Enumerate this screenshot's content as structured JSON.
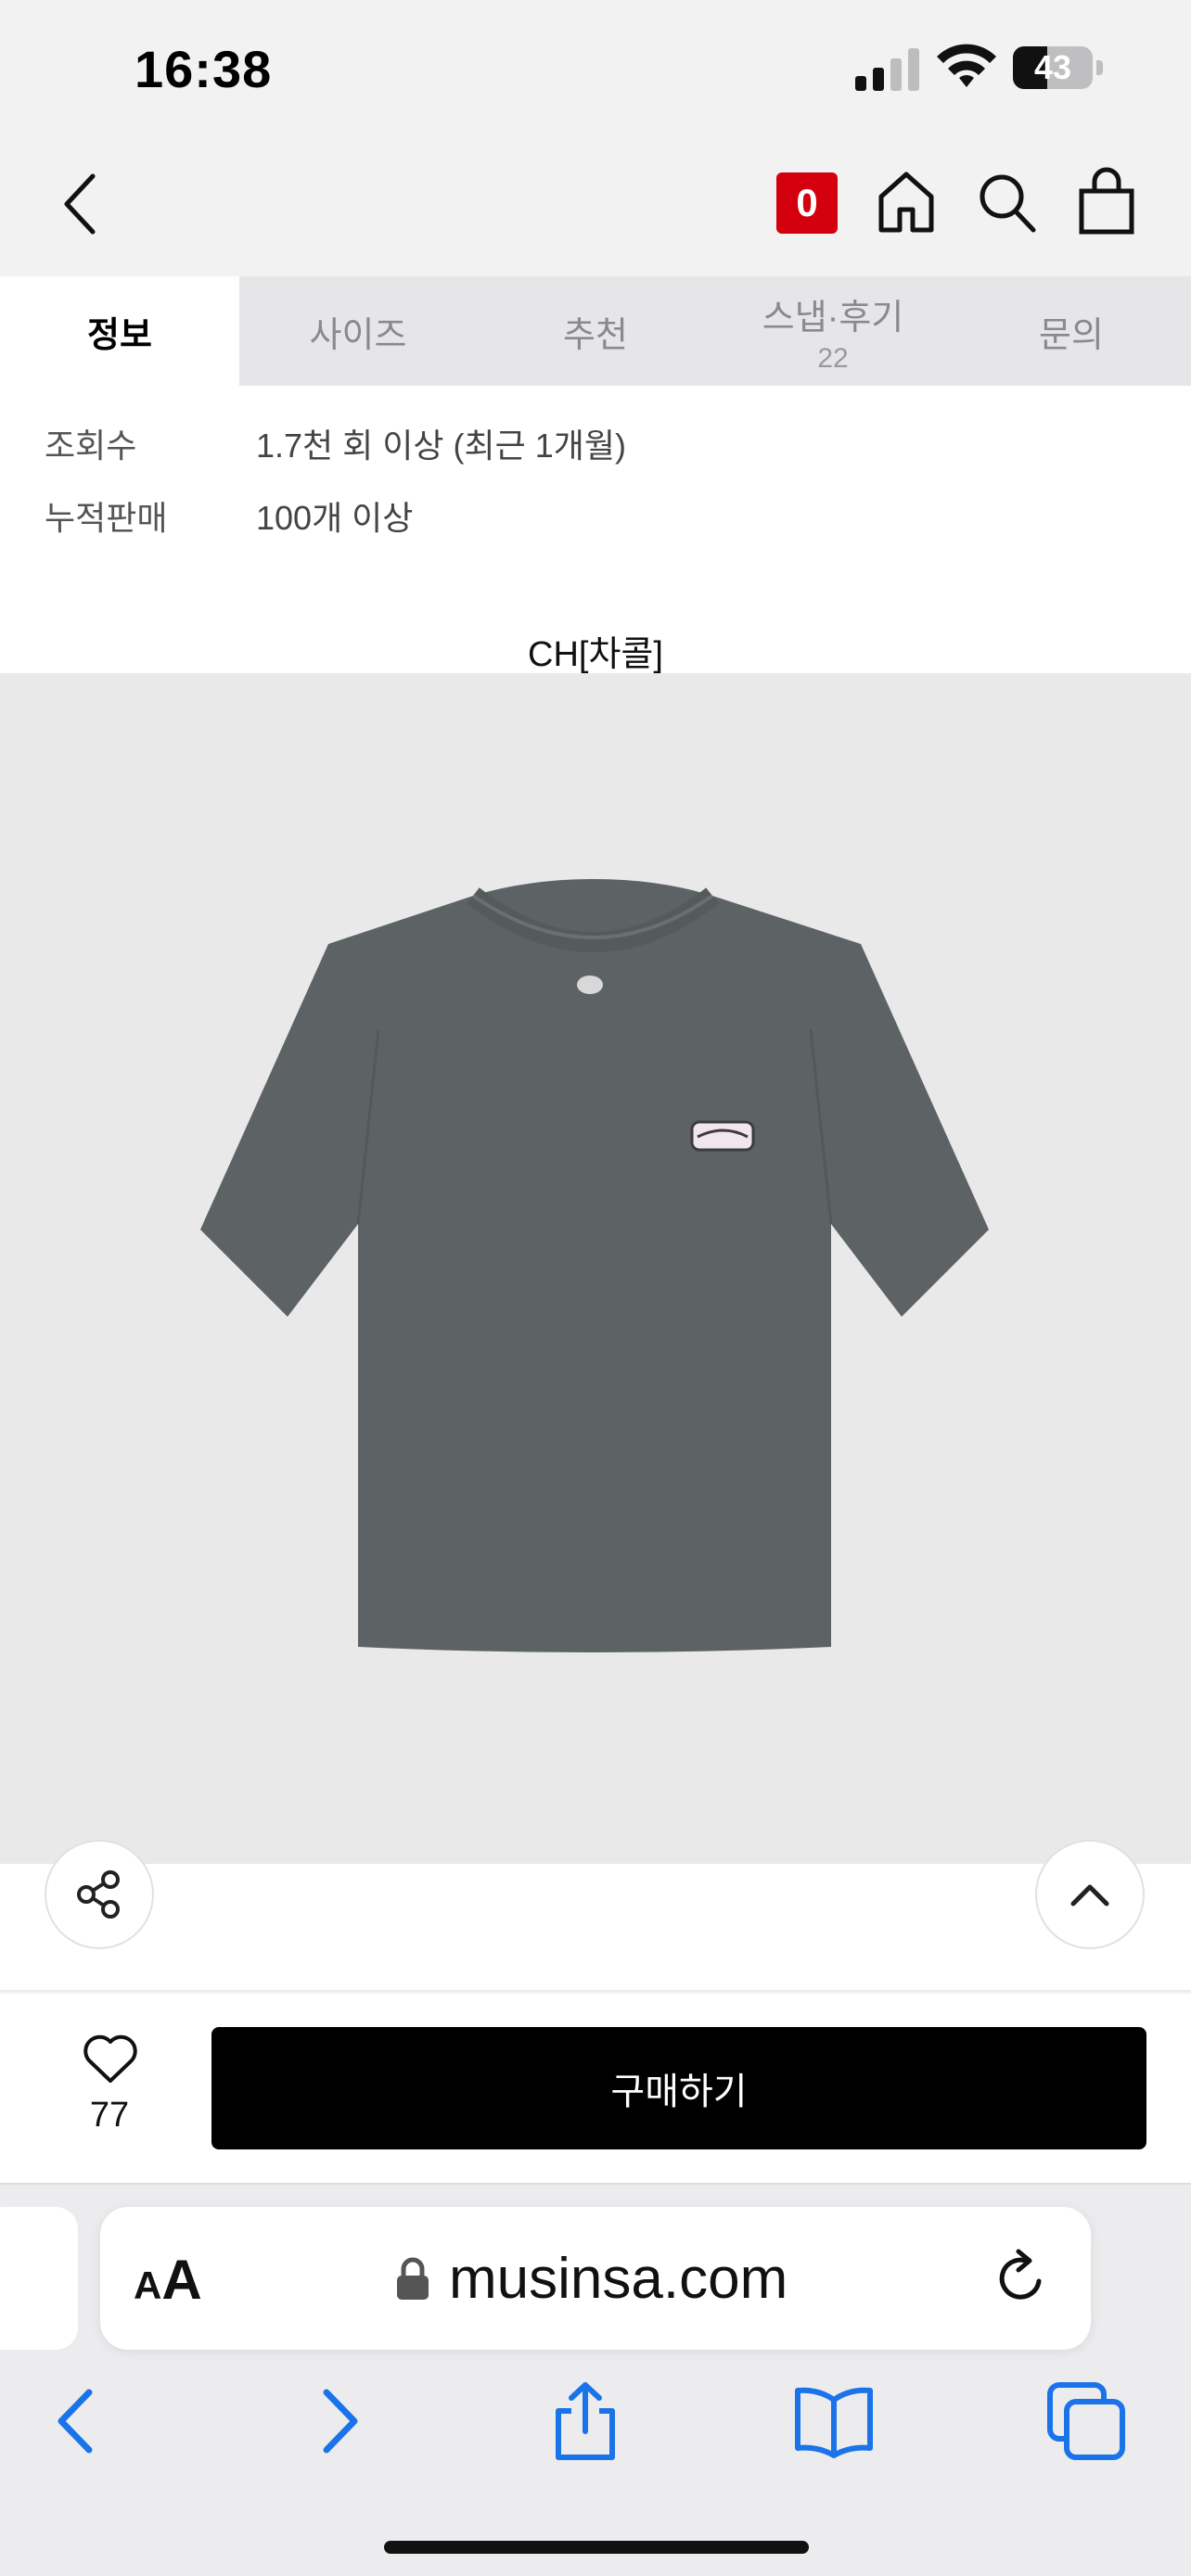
{
  "status_bar": {
    "time": "16:38",
    "battery": "43",
    "battery_level": 0.43
  },
  "header": {
    "icons": [
      "back-icon",
      "home-icon",
      "search-icon",
      "shopping-bag-icon"
    ],
    "cart_count": "0",
    "colors": {
      "cart_badge": "#d4000e"
    }
  },
  "tabs": [
    {
      "label": "정보",
      "sub": "",
      "active": true
    },
    {
      "label": "사이즈",
      "sub": ""
    },
    {
      "label": "추천",
      "sub": ""
    },
    {
      "label": "스냅·후기",
      "sub": "22"
    },
    {
      "label": "문의",
      "sub": ""
    }
  ],
  "info": {
    "rows": [
      {
        "label": "조회수",
        "value": "1.7천 회 이상 (최근 1개월)"
      },
      {
        "label": "누적판매",
        "value": "100개 이상"
      }
    ],
    "brand_caption": "CH[차콜]"
  },
  "product_image": {
    "alt": "charcoal t-shirt",
    "color": "#5d6264"
  },
  "actions": {
    "like_count": "77",
    "buy_label": "구매하기",
    "icons": [
      "share-icon",
      "chevron-up-icon",
      "heart-icon"
    ]
  },
  "browser": {
    "aa_small": "A",
    "aa_large": "A",
    "url": "musinsa.com",
    "accent": "#1a73e8",
    "nav_icons": [
      "back-arrow-icon",
      "forward-arrow-icon",
      "share-icon",
      "bookmarks-icon",
      "tabs-icon"
    ]
  }
}
